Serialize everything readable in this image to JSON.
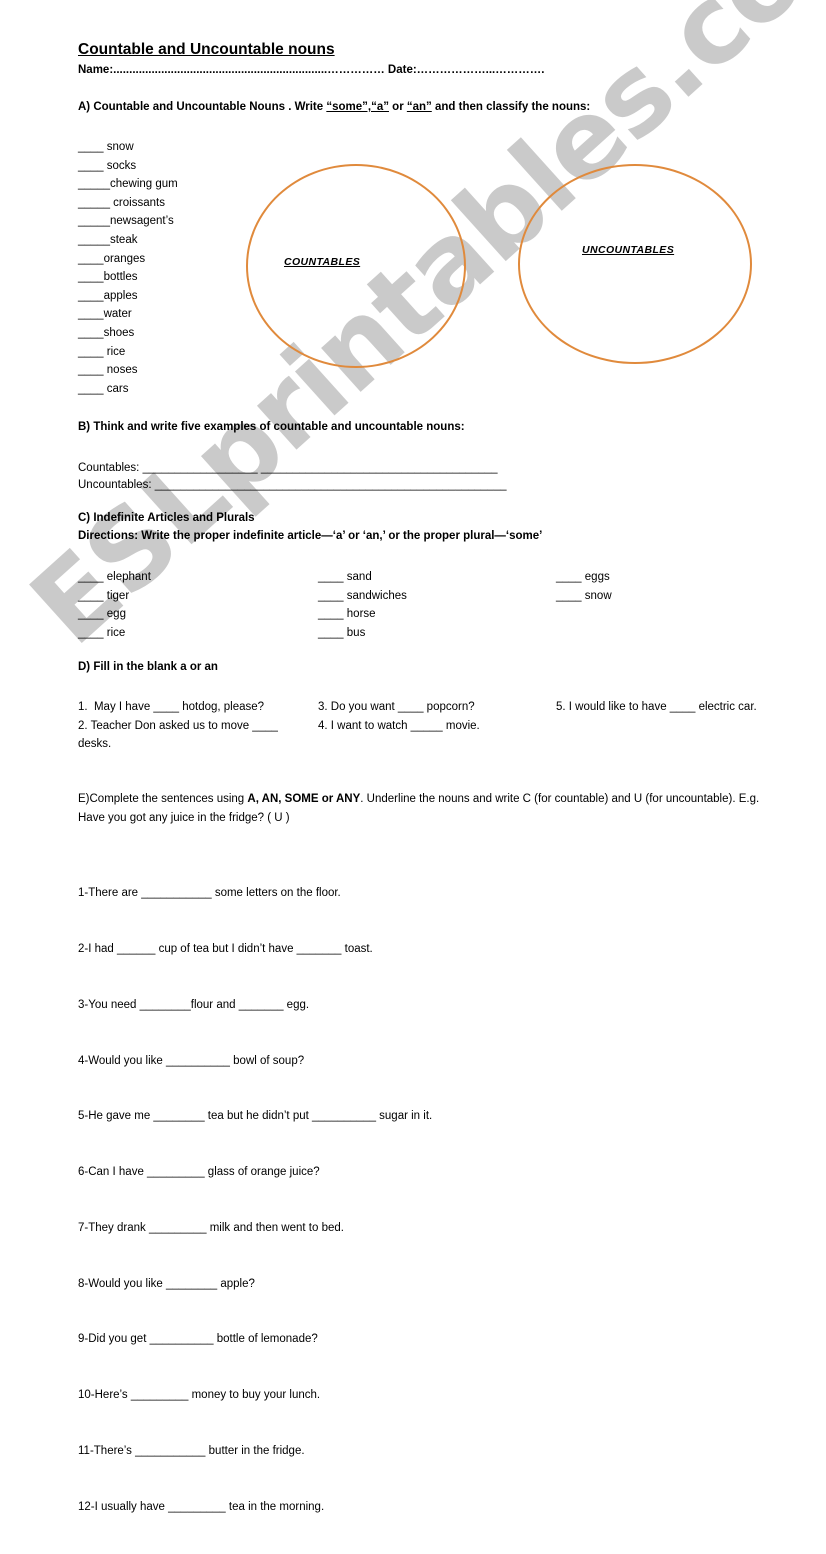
{
  "document": {
    "title": "Countable and Uncountable nouns",
    "name_date_line": "Name:...................................................................…………… Date:………………...………….",
    "watermark": "ESLprintables.com",
    "accent_color": "#e08a3c"
  },
  "section_a": {
    "heading_prefix": "A) Countable and Uncountable Nouns . Write ",
    "heading_quote1": "“some”,“a”",
    "heading_middle": " or ",
    "heading_quote2": "“an”",
    "heading_suffix": " and then classify the nouns:",
    "words": [
      "____ snow",
      "____ socks",
      "_____chewing gum",
      "_____ croissants",
      "_____newsagent’s",
      "_____steak",
      "____oranges",
      "____bottles",
      "____apples",
      "____water",
      "____shoes",
      "____ rice",
      "____ noses",
      "____ cars"
    ],
    "circle_left_label": "COUNTABLES",
    "circle_right_label": "UNCOUNTABLES"
  },
  "section_b": {
    "heading": "B) Think and write  five examples of countable and uncountable nouns:",
    "line1": "Countables: __________________ _____________________________________",
    "line2": "Uncountables: _______________________________________________________"
  },
  "section_c": {
    "heading": "C) Indefinite Articles and Plurals",
    "directions": "Directions: Write the proper indefinite article—‘a’ or ‘an,’ or the proper plural—‘some’",
    "col1": [
      "____ elephant",
      "____ tiger",
      "____ egg",
      "____ rice"
    ],
    "col2": [
      "____ sand",
      "____ sandwiches",
      "____ horse",
      "____ bus"
    ],
    "col3": [
      "____ eggs",
      "____ snow"
    ]
  },
  "section_d": {
    "heading": "D) Fill in the blank   a or an",
    "col1": "1.  May I have ____ hotdog, please?\n2. Teacher Don asked us to move ____ desks.",
    "col2": "3. Do you want ____ popcorn?\n4. I want to watch _____ movie.",
    "col3": "5. I would like to have ____ electric car."
  },
  "section_e": {
    "heading_part1": "E)Complete the sentences using ",
    "heading_bold": "A, AN, SOME or ANY",
    "heading_part2": ". Underline the nouns and write C (for countable) and U (for uncountable). E.g. Have you got any juice in the fridge? ( U )",
    "sentences": [
      "1-There are ___________ some letters on the floor.",
      "2-I had ______ cup of tea but I didn’t have _______ toast.",
      "3-You need ________flour and _______ egg.",
      "4-Would you like __________ bowl of soup?",
      "5-He gave me ________ tea but he didn’t put __________ sugar in it.",
      "6-Can I have _________ glass of orange juice?",
      "7-They drank _________ milk and then went to bed.",
      "8-Would you like ________ apple?",
      "9-Did you get __________ bottle of lemonade?",
      "10-Here’s _________ money to buy your lunch.",
      "11-There’s ___________ butter in the fridge.",
      "12-I usually have _________ tea in the morning."
    ]
  }
}
